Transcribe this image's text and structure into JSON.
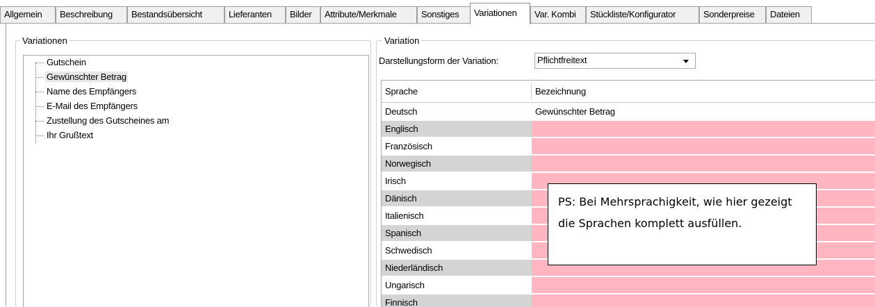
{
  "tabs": [
    {
      "label": "Allgemein",
      "active": false
    },
    {
      "label": "Beschreibung",
      "active": false
    },
    {
      "label": "Bestandsübersicht",
      "active": false
    },
    {
      "label": "Lieferanten",
      "active": false
    },
    {
      "label": "Bilder",
      "active": false
    },
    {
      "label": "Attribute/Merkmale",
      "active": false
    },
    {
      "label": "Sonstiges",
      "active": false
    },
    {
      "label": "Variationen",
      "active": true
    },
    {
      "label": "Var. Kombi",
      "active": false
    },
    {
      "label": "Stückliste/Konfigurator",
      "active": false
    },
    {
      "label": "Sonderpreise",
      "active": false
    },
    {
      "label": "Dateien",
      "active": false
    }
  ],
  "variationen_group": {
    "title": "Variationen",
    "items": [
      {
        "label": "Gutschein",
        "selected": false
      },
      {
        "label": "Gewünschter Betrag",
        "selected": true
      },
      {
        "label": "Name des Empfängers",
        "selected": false
      },
      {
        "label": "E-Mail des Empfängers",
        "selected": false
      },
      {
        "label": "Zustellung des Gutscheines am",
        "selected": false
      },
      {
        "label": "Ihr Grußtext",
        "selected": false
      }
    ]
  },
  "variation_group": {
    "title": "Variation",
    "darstellungsform_label": "Darstellungsform der Variation:",
    "darstellungsform_value": "Pflichtfreitext"
  },
  "grid": {
    "columns": [
      "Sprache",
      "Bezeichnung"
    ],
    "rows": [
      {
        "sprache": "Deutsch",
        "bezeichnung": "Gewünschter Betrag"
      },
      {
        "sprache": "Englisch",
        "bezeichnung": ""
      },
      {
        "sprache": "Französisch",
        "bezeichnung": ""
      },
      {
        "sprache": "Norwegisch",
        "bezeichnung": ""
      },
      {
        "sprache": "Irisch",
        "bezeichnung": ""
      },
      {
        "sprache": "Dänisch",
        "bezeichnung": ""
      },
      {
        "sprache": "Italienisch",
        "bezeichnung": ""
      },
      {
        "sprache": "Spanisch",
        "bezeichnung": ""
      },
      {
        "sprache": "Schwedisch",
        "bezeichnung": ""
      },
      {
        "sprache": "Niederländisch",
        "bezeichnung": ""
      },
      {
        "sprache": "Ungarisch",
        "bezeichnung": ""
      },
      {
        "sprache": "Finnisch",
        "bezeichnung": ""
      }
    ]
  },
  "callout": {
    "text": "PS: Bei Mehrsprachigkeit, wie hier gezeigt die Sprachen komplett ausfüllen."
  },
  "colors": {
    "empty_cell": "#ffb6c1",
    "alt_row": "#d4d4d4",
    "border": "#a0a0a0"
  }
}
